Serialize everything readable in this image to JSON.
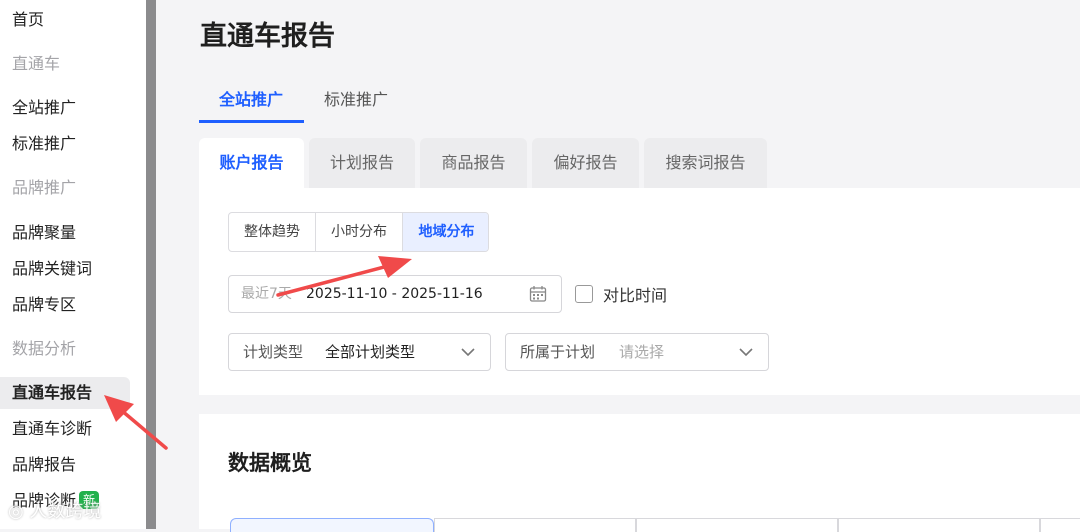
{
  "sidebar": {
    "items": [
      {
        "label": "首页",
        "type": "item"
      },
      {
        "label": "直通车",
        "type": "group"
      },
      {
        "label": "全站推广",
        "type": "item"
      },
      {
        "label": "标准推广",
        "type": "item"
      },
      {
        "label": "品牌推广",
        "type": "group"
      },
      {
        "label": "品牌聚量",
        "type": "item"
      },
      {
        "label": "品牌关键词",
        "type": "item"
      },
      {
        "label": "品牌专区",
        "type": "item"
      },
      {
        "label": "数据分析",
        "type": "group"
      },
      {
        "label": "直通车报告",
        "type": "item",
        "active": true
      },
      {
        "label": "直通车诊断",
        "type": "item"
      },
      {
        "label": "品牌报告",
        "type": "item"
      },
      {
        "label": "品牌诊断",
        "type": "item",
        "badge": "新"
      }
    ]
  },
  "watermark": "◎ 人数跨境",
  "header": {
    "title": "直通车报告"
  },
  "primary_tabs": [
    {
      "label": "全站推广",
      "active": true
    },
    {
      "label": "标准推广",
      "active": false
    }
  ],
  "report_tabs": [
    {
      "label": "账户报告",
      "active": true
    },
    {
      "label": "计划报告",
      "active": false
    },
    {
      "label": "商品报告",
      "active": false
    },
    {
      "label": "偏好报告",
      "active": false
    },
    {
      "label": "搜索词报告",
      "active": false
    }
  ],
  "view_toggle": [
    {
      "label": "整体趋势",
      "active": false
    },
    {
      "label": "小时分布",
      "active": false
    },
    {
      "label": "地域分布",
      "active": true
    }
  ],
  "date_range": {
    "prefix": "最近7天",
    "value": "2025-11-10 - 2025-11-16"
  },
  "compare": {
    "label": "对比时间",
    "checked": false
  },
  "filters": {
    "plan_type": {
      "label": "计划类型",
      "value": "全部计划类型"
    },
    "plan": {
      "label": "所属于计划",
      "placeholder": "请选择"
    }
  },
  "overview": {
    "title": "数据概览"
  },
  "colors": {
    "accent": "#1f5fff",
    "annotation_arrow": "#f04a4a",
    "badge": "#22b14c"
  },
  "icons": [
    "calendar-icon",
    "chevron-down-icon",
    "checkbox"
  ]
}
